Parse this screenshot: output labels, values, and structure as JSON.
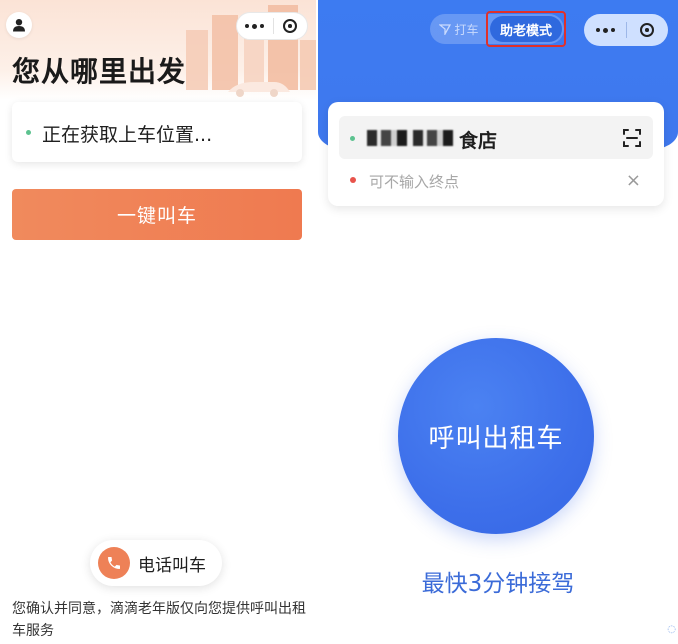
{
  "left": {
    "title": "您从哪里出发",
    "pickup_status": "正在获取上车位置...",
    "call_button": "一键叫车",
    "phone_call": "电话叫车",
    "footer": "您确认并同意，滴滴老年版仅向您提供呼叫出租车服务",
    "icons": {
      "profile": "user-icon",
      "more": "more-dots-icon",
      "close": "target-circle-icon",
      "phone": "phone-icon"
    }
  },
  "right": {
    "tabs": {
      "hail": "打车",
      "elder_mode": "助老模式"
    },
    "start_location": "食店",
    "destination_placeholder": "可不输入终点",
    "clear_symbol": "×",
    "main_button": "呼叫出租车",
    "subtitle": "最快3分钟接驾",
    "icons": {
      "scan": "scan-icon",
      "clear": "close-icon",
      "more": "more-dots-icon",
      "close": "target-circle-icon"
    }
  },
  "colors": {
    "orange": "#ef7a50",
    "blue": "#3d7bf1",
    "highlight_red": "#e0302a",
    "start_dot": "#5cc28f",
    "end_dot": "#e8534b"
  }
}
